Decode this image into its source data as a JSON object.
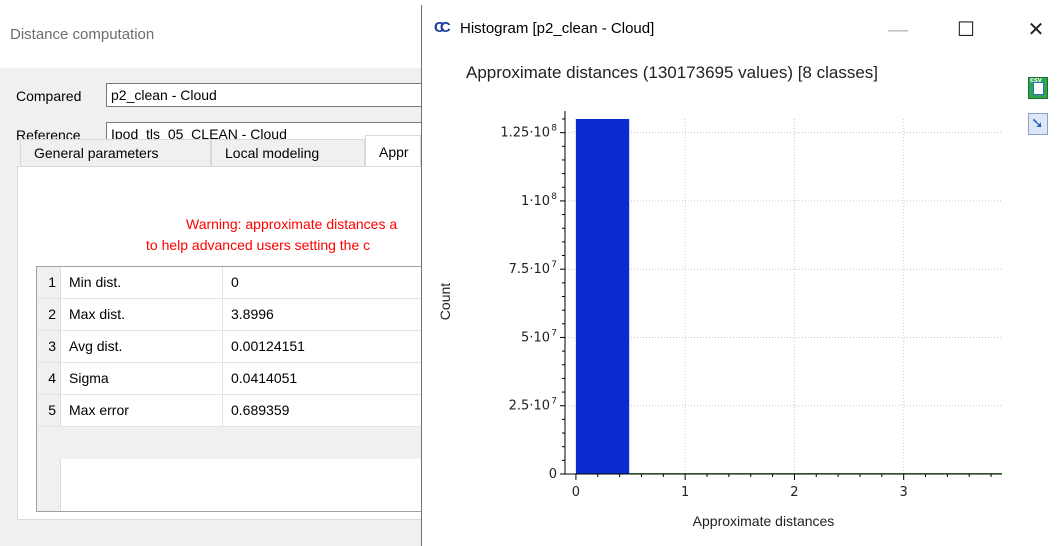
{
  "dist_dialog": {
    "title": "Distance computation",
    "compared_label": "Compared",
    "compared_value": "p2_clean - Cloud",
    "reference_label": "Reference",
    "reference_value": "Ipod_tls_05_CLEAN - Cloud",
    "tabs": [
      {
        "label": "General parameters"
      },
      {
        "label": "Local modeling"
      },
      {
        "label": "Appr"
      }
    ],
    "warning_line1": "Warning: approximate distances a",
    "warning_line2": "to help advanced users setting the c",
    "stats": [
      {
        "num": "1",
        "name": "Min dist.",
        "value": "0"
      },
      {
        "num": "2",
        "name": "Max dist.",
        "value": "3.8996"
      },
      {
        "num": "3",
        "name": "Avg dist.",
        "value": "0.00124151"
      },
      {
        "num": "4",
        "name": "Sigma",
        "value": "0.0414051"
      },
      {
        "num": "5",
        "name": "Max error",
        "value": "0.689359"
      }
    ]
  },
  "histogram_window": {
    "title": "Histogram [p2_clean - Cloud]",
    "logo_text": "CC",
    "minimize_glyph": "—",
    "maximize_glyph": "☐",
    "close_glyph": "✕",
    "csv_icon_text": "csv",
    "accent_bar_color": "#0a2bd0"
  },
  "chart_data": {
    "type": "bar",
    "title": "Approximate distances (130173695 values) [8 classes]",
    "xlabel": "Approximate distances",
    "ylabel": "Count",
    "bin_edges": [
      0,
      0.48745,
      0.9749,
      1.46235,
      1.9498,
      2.43725,
      2.9247,
      3.41215,
      3.8996
    ],
    "values": [
      130000000,
      150000,
      20000,
      2000,
      500,
      100,
      50,
      10
    ],
    "xlim": [
      -0.1,
      3.9
    ],
    "ylim": [
      0,
      130000000
    ],
    "x_ticks": [
      {
        "v": 0,
        "label": "0"
      },
      {
        "v": 1,
        "label": "1"
      },
      {
        "v": 2,
        "label": "2"
      },
      {
        "v": 3,
        "label": "3"
      }
    ],
    "y_ticks": [
      {
        "v": 0,
        "mant": "0",
        "exp": ""
      },
      {
        "v": 25000000,
        "mant": "2.5·10",
        "exp": "7"
      },
      {
        "v": 50000000,
        "mant": "5·10",
        "exp": "7"
      },
      {
        "v": 75000000,
        "mant": "7.5·10",
        "exp": "7"
      },
      {
        "v": 100000000,
        "mant": "1·10",
        "exp": "8"
      },
      {
        "v": 125000000,
        "mant": "1.25·10",
        "exp": "8"
      }
    ],
    "grid": true,
    "bar_color": "#0a2bd0",
    "small_bar_color": "#4caf50"
  }
}
